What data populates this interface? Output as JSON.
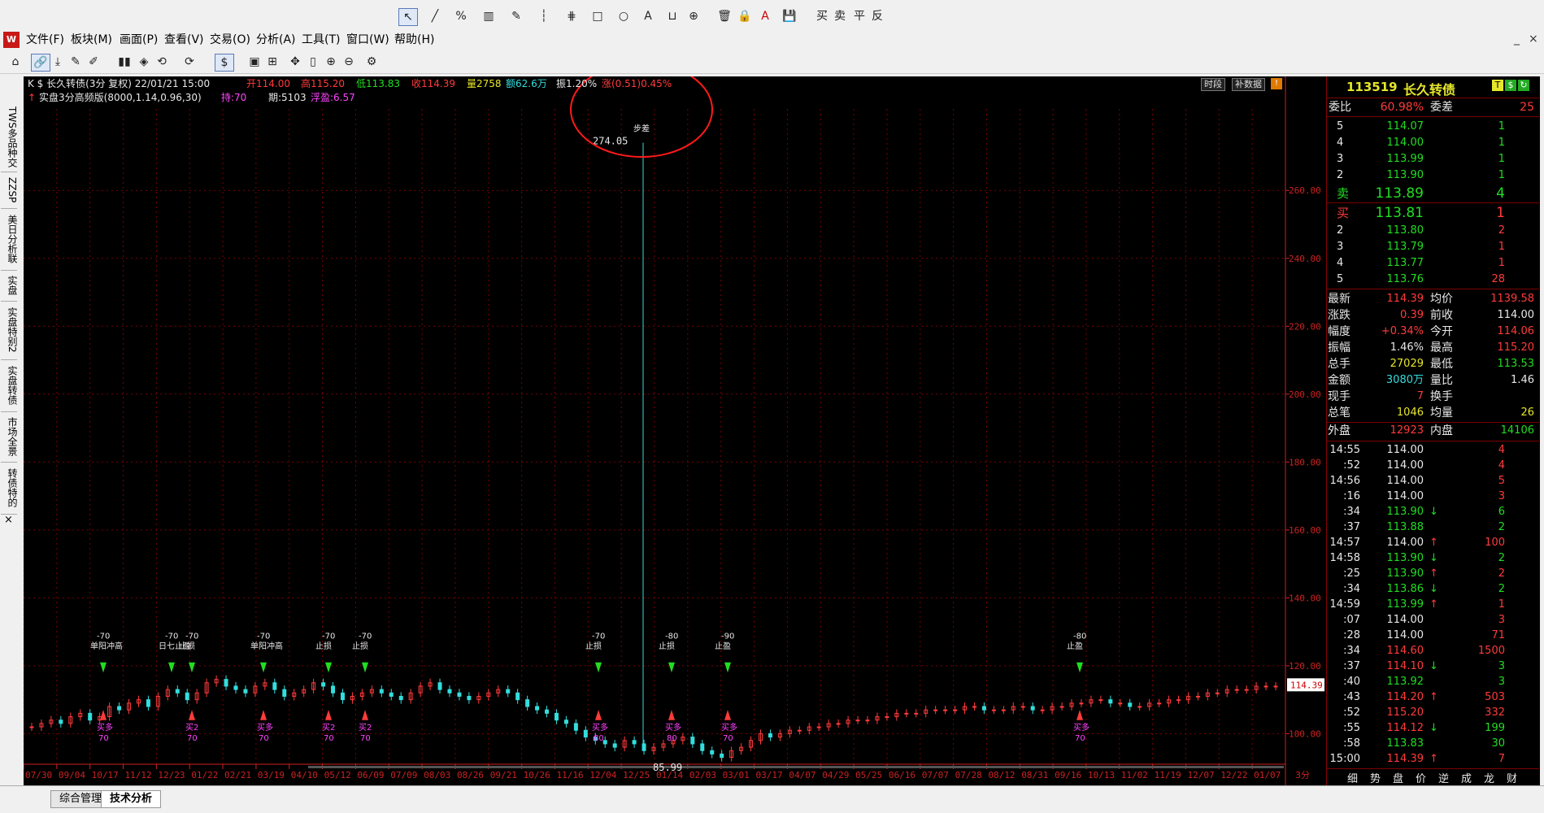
{
  "drawing_toolbar": {
    "tools": [
      "↖",
      "╱",
      "%",
      "▥",
      "✎",
      "┆",
      "⋕",
      "□",
      "○",
      "A",
      "⊔",
      "⊕",
      "🗑",
      "🔒",
      "A",
      "💾"
    ],
    "text_buttons": [
      "买",
      "卖",
      "平",
      "反"
    ]
  },
  "menubar": {
    "items": [
      "文件(F)",
      "板块(M)",
      "画面(P)",
      "查看(V)",
      "交易(O)",
      "分析(A)",
      "工具(T)",
      "窗口(W)",
      "帮助(H)"
    ],
    "window_controls": [
      "_",
      "×"
    ]
  },
  "icon_toolbar": {
    "buttons": [
      "⌂",
      "🔗",
      "⤓",
      "✎",
      "✐",
      "▮▮",
      "◈",
      "⟲",
      "$",
      "⟳",
      "▣",
      "⊞",
      "✥",
      "▯",
      "⊕",
      "⊖",
      "⚙"
    ]
  },
  "left_tabs": [
    "TWS多品种交",
    "ZZSP",
    "美日分析联",
    "实盘",
    "实盘特别2",
    "实盘转债",
    "市场全景",
    "转债特的",
    "×"
  ],
  "chart_header": {
    "symbol": "K $ 长久转债(3分 复权)",
    "datetime": "22/01/21 15:00",
    "open": "开114.00",
    "high": "高115.20",
    "low": "低113.83",
    "close": "收114.39",
    "volume": "量2758",
    "amount": "额62.6万",
    "amplitude": "振1.20%",
    "change": "涨(0.51)0.45%",
    "buttons": [
      "时段",
      "补数据"
    ],
    "strategy": "实盘3分高频版(8000,1.14,0.96,30)",
    "hold": "持:70",
    "period": "期:5103",
    "float_profit": "浮盈:6.57"
  },
  "chart_data": {
    "type": "candlestick",
    "y_ticks": [
      "260.00",
      "240.00",
      "220.00",
      "200.00",
      "180.00",
      "160.00",
      "140.00",
      "120.00",
      "100.00"
    ],
    "ylim": [
      91,
      284
    ],
    "x_ticks": [
      "07/30",
      "09/04",
      "10/17",
      "11/12",
      "12/23",
      "01/22",
      "02/21",
      "03/19",
      "04/10",
      "05/12",
      "06/09",
      "07/09",
      "08/03",
      "08/26",
      "09/21",
      "10/26",
      "11/16",
      "12/04",
      "12/25",
      "01/14",
      "02/03",
      "03/01",
      "03/17",
      "04/07",
      "04/29",
      "05/25",
      "06/16",
      "07/07",
      "07/28",
      "08/12",
      "08/31",
      "09/16",
      "10/13",
      "11/02",
      "11/19",
      "12/07",
      "12/22",
      "01/07"
    ],
    "period_label": "3分",
    "last_price_tag": "114.39",
    "annotations": [
      {
        "text": "274.05",
        "kind": "high"
      },
      {
        "text": "85.99",
        "kind": "low"
      },
      {
        "text": "步差",
        "kind": "label"
      },
      {
        "text": "-70",
        "kind": "signal"
      },
      {
        "text": "单阳冲高",
        "kind": "signal"
      },
      {
        "text": "日七止盈",
        "kind": "signal"
      },
      {
        "text": "止损",
        "kind": "signal"
      },
      {
        "text": "止盈",
        "kind": "signal"
      },
      {
        "text": "-80",
        "kind": "signal"
      },
      {
        "text": "-90",
        "kind": "signal"
      },
      {
        "text": "买多",
        "kind": "entry"
      },
      {
        "text": "买2",
        "kind": "entry"
      },
      {
        "text": "70",
        "kind": "entry"
      },
      {
        "text": "80",
        "kind": "entry"
      }
    ],
    "price_series": [
      102,
      103,
      104,
      103,
      105,
      106,
      104,
      105,
      108,
      107,
      109,
      110,
      108,
      111,
      113,
      112,
      110,
      112,
      115,
      116,
      114,
      113,
      112,
      114,
      115,
      113,
      111,
      112,
      113,
      115,
      114,
      112,
      110,
      111,
      112,
      113,
      112,
      111,
      110,
      112,
      114,
      115,
      113,
      112,
      111,
      110,
      111,
      112,
      113,
      112,
      110,
      108,
      107,
      106,
      104,
      103,
      101,
      99,
      98,
      97,
      96,
      98,
      97,
      95,
      96,
      97,
      98,
      99,
      97,
      95,
      94,
      93,
      95,
      96,
      98,
      100,
      99,
      100,
      101,
      101,
      102,
      102,
      103,
      103,
      104,
      104,
      104,
      105,
      105,
      106,
      106,
      106,
      107,
      107,
      107,
      107,
      108,
      108,
      107,
      107,
      107,
      108,
      108,
      107,
      107,
      108,
      108,
      109,
      109,
      110,
      110,
      109,
      109,
      108,
      108,
      109,
      109,
      110,
      110,
      111,
      111,
      112,
      112,
      113,
      113,
      113,
      114,
      114,
      114
    ]
  },
  "quote_panel": {
    "code": "113519",
    "name": "长久转债",
    "weibi_label": "委比",
    "weibi": "60.98%",
    "weicha_label": "委差",
    "weicha": "25",
    "asks": [
      {
        "level": "5",
        "price": "114.07",
        "vol": "1"
      },
      {
        "level": "4",
        "price": "114.00",
        "vol": "1"
      },
      {
        "level": "3",
        "price": "113.99",
        "vol": "1"
      },
      {
        "level": "2",
        "price": "113.90",
        "vol": "1"
      },
      {
        "level": "卖",
        "price": "113.89",
        "vol": "4"
      }
    ],
    "bids": [
      {
        "level": "买",
        "price": "113.81",
        "vol": "1"
      },
      {
        "level": "2",
        "price": "113.80",
        "vol": "2"
      },
      {
        "level": "3",
        "price": "113.79",
        "vol": "1"
      },
      {
        "level": "4",
        "price": "113.77",
        "vol": "1"
      },
      {
        "level": "5",
        "price": "113.76",
        "vol": "28"
      }
    ],
    "stats": [
      {
        "l1": "最新",
        "v1": "114.39",
        "c1": "#ff3b3b",
        "l2": "均价",
        "v2": "1139.58",
        "c2": "#ff3b3b"
      },
      {
        "l1": "涨跌",
        "v1": "0.39",
        "c1": "#ff3b3b",
        "l2": "前收",
        "v2": "114.00",
        "c2": "#e8e8e8"
      },
      {
        "l1": "幅度",
        "v1": "+0.34%",
        "c1": "#ff3b3b",
        "l2": "今开",
        "v2": "114.06",
        "c2": "#ff3b3b"
      },
      {
        "l1": "振幅",
        "v1": "1.46%",
        "c1": "#e8e8e8",
        "l2": "最高",
        "v2": "115.20",
        "c2": "#ff3b3b"
      },
      {
        "l1": "总手",
        "v1": "27029",
        "c1": "#e6e62a",
        "l2": "最低",
        "v2": "113.53",
        "c2": "#22dd22"
      },
      {
        "l1": "金额",
        "v1": "3080万",
        "c1": "#33dddd",
        "l2": "量比",
        "v2": "1.46",
        "c2": "#e8e8e8"
      },
      {
        "l1": "现手",
        "v1": "7",
        "c1": "#ff3b3b",
        "l2": "换手",
        "v2": "",
        "c2": "#e8e8e8"
      },
      {
        "l1": "总笔",
        "v1": "1046",
        "c1": "#e6e62a",
        "l2": "均量",
        "v2": "26",
        "c2": "#e6e62a"
      }
    ],
    "outer_label": "外盘",
    "outer": "12923",
    "inner_label": "内盘",
    "inner": "14106",
    "ticks": [
      {
        "t": "14:55",
        "p": "114.00",
        "a": "",
        "v": "4",
        "pc": "#e8e8e8",
        "vc": "#ff3b3b"
      },
      {
        "t": ":52",
        "p": "114.00",
        "a": "",
        "v": "4",
        "pc": "#e8e8e8",
        "vc": "#ff3b3b"
      },
      {
        "t": "14:56",
        "p": "114.00",
        "a": "",
        "v": "5",
        "pc": "#e8e8e8",
        "vc": "#ff3b3b"
      },
      {
        "t": ":16",
        "p": "114.00",
        "a": "",
        "v": "3",
        "pc": "#e8e8e8",
        "vc": "#ff3b3b"
      },
      {
        "t": ":34",
        "p": "113.90",
        "a": "↓",
        "v": "6",
        "pc": "#22dd22",
        "vc": "#22dd22"
      },
      {
        "t": ":37",
        "p": "113.88",
        "a": "",
        "v": "2",
        "pc": "#22dd22",
        "vc": "#22dd22"
      },
      {
        "t": "14:57",
        "p": "114.00",
        "a": "↑",
        "v": "100",
        "pc": "#e8e8e8",
        "vc": "#ff3b3b"
      },
      {
        "t": "14:58",
        "p": "113.90",
        "a": "↓",
        "v": "2",
        "pc": "#22dd22",
        "vc": "#22dd22"
      },
      {
        "t": ":25",
        "p": "113.90",
        "a": "↑",
        "v": "2",
        "pc": "#22dd22",
        "vc": "#ff3b3b"
      },
      {
        "t": ":34",
        "p": "113.86",
        "a": "↓",
        "v": "2",
        "pc": "#22dd22",
        "vc": "#22dd22"
      },
      {
        "t": "14:59",
        "p": "113.99",
        "a": "↑",
        "v": "1",
        "pc": "#22dd22",
        "vc": "#ff3b3b"
      },
      {
        "t": ":07",
        "p": "114.00",
        "a": "",
        "v": "3",
        "pc": "#e8e8e8",
        "vc": "#ff3b3b"
      },
      {
        "t": ":28",
        "p": "114.00",
        "a": "",
        "v": "71",
        "pc": "#e8e8e8",
        "vc": "#ff3b3b"
      },
      {
        "t": ":34",
        "p": "114.60",
        "a": "",
        "v": "1500",
        "pc": "#ff3b3b",
        "vc": "#ff3b3b"
      },
      {
        "t": ":37",
        "p": "114.10",
        "a": "↓",
        "v": "3",
        "pc": "#ff3b3b",
        "vc": "#22dd22"
      },
      {
        "t": ":40",
        "p": "113.92",
        "a": "",
        "v": "3",
        "pc": "#22dd22",
        "vc": "#22dd22"
      },
      {
        "t": ":43",
        "p": "114.20",
        "a": "↑",
        "v": "503",
        "pc": "#ff3b3b",
        "vc": "#ff3b3b"
      },
      {
        "t": ":52",
        "p": "115.20",
        "a": "",
        "v": "332",
        "pc": "#ff3b3b",
        "vc": "#ff3b3b"
      },
      {
        "t": ":55",
        "p": "114.12",
        "a": "↓",
        "v": "199",
        "pc": "#ff3b3b",
        "vc": "#22dd22"
      },
      {
        "t": ":58",
        "p": "113.83",
        "a": "",
        "v": "30",
        "pc": "#22dd22",
        "vc": "#22dd22"
      },
      {
        "t": "15:00",
        "p": "114.39",
        "a": "↑",
        "v": "7",
        "pc": "#ff3b3b",
        "vc": "#ff3b3b"
      }
    ],
    "bottom_tabs": [
      "细",
      "势",
      "盘",
      "价",
      "逆",
      "成",
      "龙",
      "财"
    ]
  },
  "bottom_tabs": [
    "综合管理",
    "技术分析"
  ],
  "colors": {
    "up": "#ff3b3b",
    "down": "#33dddd",
    "grid": "#7a0000",
    "axis": "#cc2222"
  }
}
